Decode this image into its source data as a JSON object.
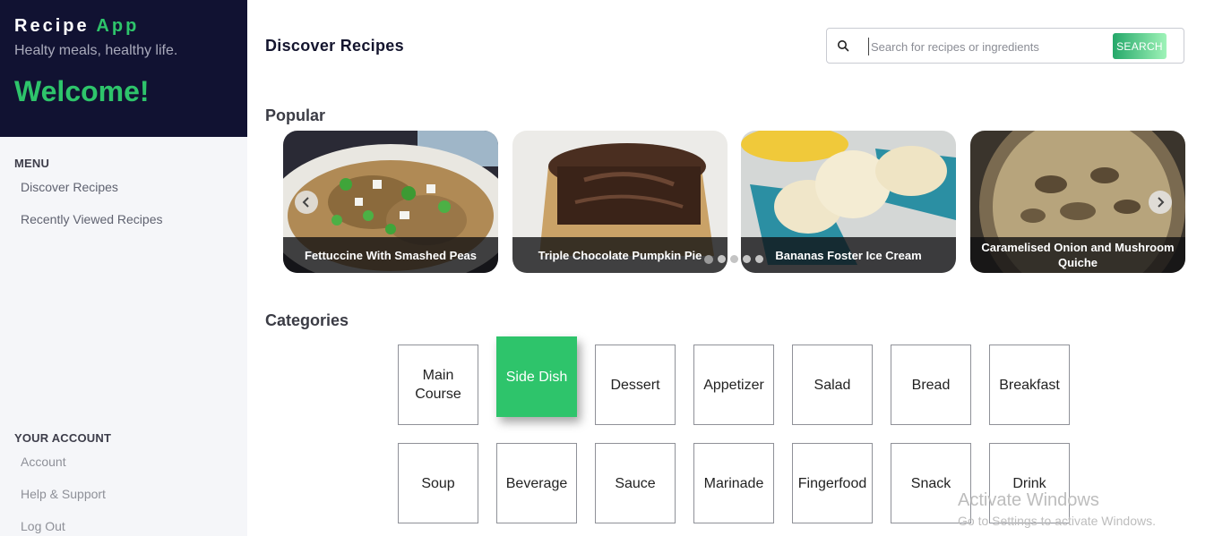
{
  "sidebar": {
    "brand": {
      "name": "Recipe",
      "accent": "App",
      "tagline": "Healty meals, healthy life.",
      "welcome": "Welcome!"
    },
    "menu_heading": "MENU",
    "menu": [
      "Discover Recipes",
      "Recently Viewed Recipes"
    ],
    "account_heading": "YOUR ACCOUNT",
    "account": [
      "Account",
      "Help & Support",
      "Log Out"
    ]
  },
  "header": {
    "title": "Discover Recipes",
    "search": {
      "placeholder": "Search for recipes or ingredients",
      "value": "",
      "button": "SEARCH",
      "icon": "search-icon"
    }
  },
  "popular": {
    "heading": "Popular",
    "cards": [
      "Fettuccine With Smashed Peas",
      "Triple Chocolate Pumpkin Pie",
      "Bananas Foster Ice Cream",
      "Caramelised Onion and Mushroom Quiche"
    ],
    "slide_count": 5,
    "active_slide": 1
  },
  "categories": {
    "heading": "Categories",
    "items": [
      "Main Course",
      "Side Dish",
      "Dessert",
      "Appetizer",
      "Salad",
      "Bread",
      "Breakfast",
      "Soup",
      "Beverage",
      "Sauce",
      "Marinade",
      "Fingerfood",
      "Snack",
      "Drink"
    ],
    "active": "Side Dish"
  },
  "watermark": {
    "title": "Activate Windows",
    "subtitle": "Go to Settings to activate Windows."
  },
  "colors": {
    "sidebar_header": "#111232",
    "accent": "#2ec46b",
    "sidebar_bg": "#f5f6f9"
  }
}
